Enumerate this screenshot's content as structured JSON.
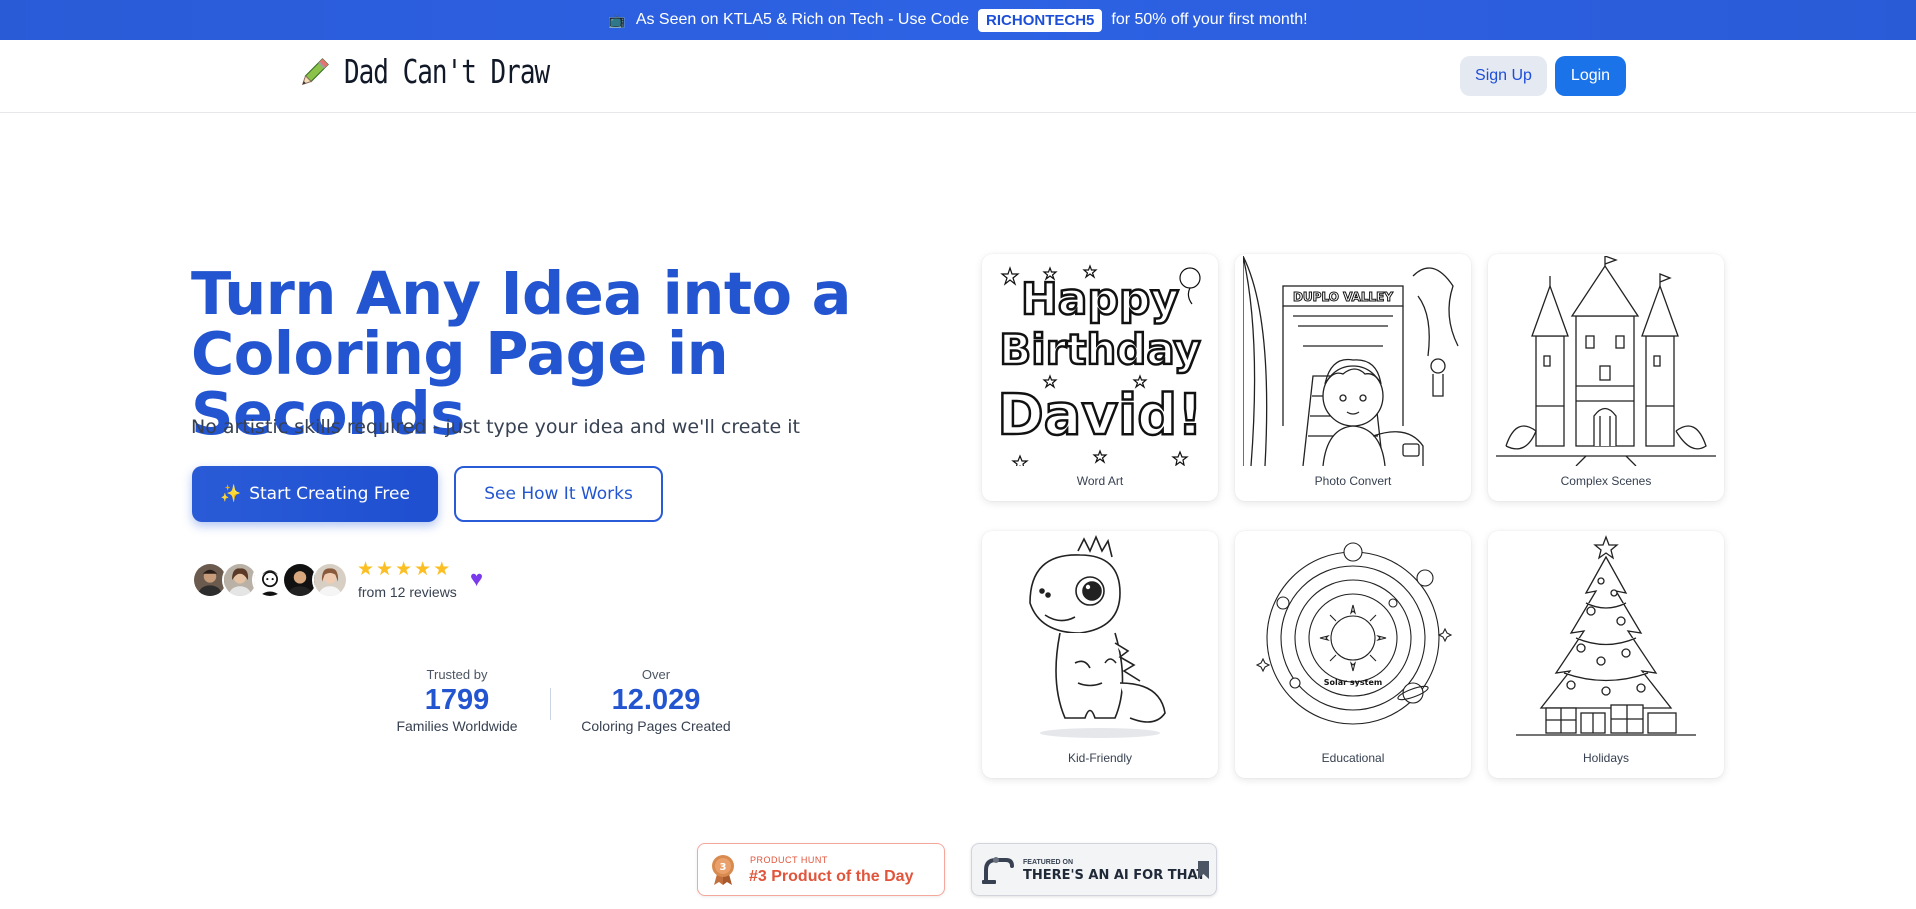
{
  "promo": {
    "text_before": "As Seen on KTLA5 & Rich on Tech - Use Code",
    "code": "RICHONTECH5",
    "text_after": "for 50% off your first month!",
    "icon": "tv-icon"
  },
  "header": {
    "logo_text": "Dad Can't Draw",
    "logo_icon": "pencil-icon",
    "signup_label": "Sign Up",
    "login_label": "Login"
  },
  "hero": {
    "title_line1": "Turn Any Idea into a",
    "title_line2": "Coloring Page in Seconds",
    "subtitle": "No artistic skills required - just type your idea and we'll create it",
    "start_label": "Start Creating Free",
    "start_icon": "sparkles-icon",
    "how_label": "See How It Works"
  },
  "reviews": {
    "rating": 5,
    "max_rating": 5,
    "text": "from 12 reviews",
    "heart_icon": "purple-heart-icon"
  },
  "stats": [
    {
      "pre": "Trusted by",
      "value": "1799",
      "post": "Families Worldwide"
    },
    {
      "pre": "Over",
      "value": "12.029",
      "post": "Coloring Pages Created"
    }
  ],
  "gallery": [
    {
      "caption": "Word Art",
      "art": {
        "line1": "Happy",
        "line2": "Birthday",
        "line3": "David!"
      }
    },
    {
      "caption": "Photo Convert",
      "art": {
        "sign": "DUPLO VALLEY"
      }
    },
    {
      "caption": "Complex Scenes"
    },
    {
      "caption": "Kid-Friendly"
    },
    {
      "caption": "Educational",
      "art": {
        "label": "Solar system"
      }
    },
    {
      "caption": "Holidays"
    }
  ],
  "badges": {
    "product_hunt": {
      "small": "PRODUCT HUNT",
      "big": "#3 Product of the Day",
      "rank": "3"
    },
    "ai": {
      "small": "FEATURED ON",
      "big": "THERE'S AN AI FOR THAT"
    }
  },
  "colors": {
    "brand_blue": "#2355d1",
    "banner_blue": "#2a5bd7",
    "login_blue": "#1a73e8",
    "star_yellow": "#fbbf24",
    "heart_purple": "#7c3aed",
    "product_hunt_red": "#e0553c"
  }
}
